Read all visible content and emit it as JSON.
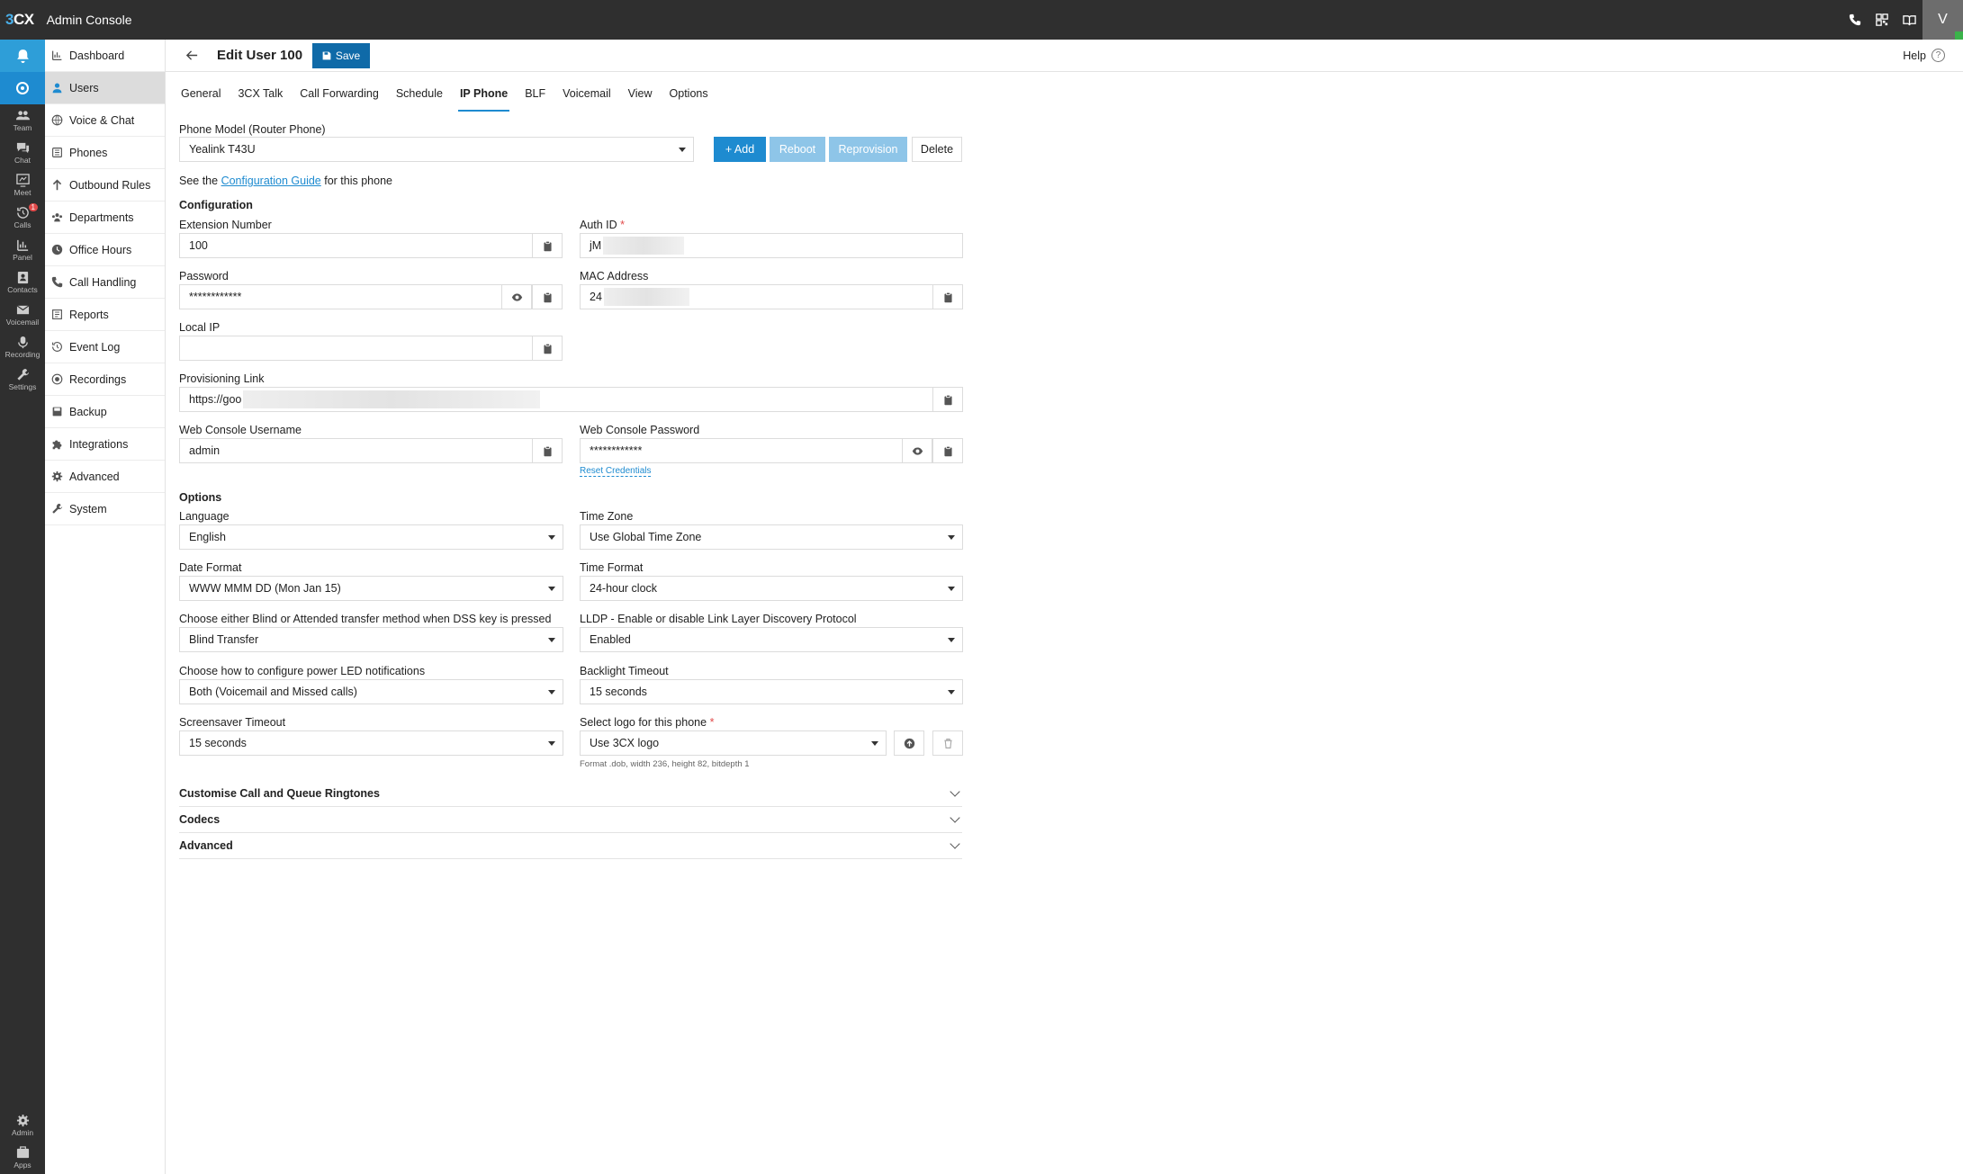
{
  "app": {
    "logo": "3CX",
    "title": "Admin Console",
    "avatar_letter": "V"
  },
  "topbar_icons": [
    "phone-icon",
    "qr-code-icon",
    "book-icon"
  ],
  "rail": {
    "items": [
      {
        "name": "team",
        "label": "Team"
      },
      {
        "name": "chat",
        "label": "Chat"
      },
      {
        "name": "meet",
        "label": "Meet"
      },
      {
        "name": "calls",
        "label": "Calls",
        "badge": "1"
      },
      {
        "name": "panel",
        "label": "Panel"
      },
      {
        "name": "contacts",
        "label": "Contacts"
      },
      {
        "name": "voicemail",
        "label": "Voicemail"
      },
      {
        "name": "recording",
        "label": "Recording"
      },
      {
        "name": "settings",
        "label": "Settings"
      }
    ],
    "bottom": [
      {
        "name": "admin",
        "label": "Admin"
      },
      {
        "name": "apps",
        "label": "Apps"
      }
    ]
  },
  "nav": {
    "items": [
      {
        "label": "Dashboard",
        "icon": "dashboard-icon"
      },
      {
        "label": "Users",
        "icon": "user-icon",
        "active": true
      },
      {
        "label": "Voice & Chat",
        "icon": "globe-icon"
      },
      {
        "label": "Phones",
        "icon": "phones-icon"
      },
      {
        "label": "Outbound Rules",
        "icon": "arrow-up-icon"
      },
      {
        "label": "Departments",
        "icon": "departments-icon"
      },
      {
        "label": "Office Hours",
        "icon": "clock-icon"
      },
      {
        "label": "Call Handling",
        "icon": "phone-icon"
      },
      {
        "label": "Reports",
        "icon": "reports-icon"
      },
      {
        "label": "Event Log",
        "icon": "history-icon"
      },
      {
        "label": "Recordings",
        "icon": "record-icon"
      },
      {
        "label": "Backup",
        "icon": "backup-icon"
      },
      {
        "label": "Integrations",
        "icon": "puzzle-icon"
      },
      {
        "label": "Advanced",
        "icon": "gear-icon"
      },
      {
        "label": "System",
        "icon": "wrench-icon"
      }
    ]
  },
  "header": {
    "title": "Edit User 100",
    "save_label": "Save",
    "help_label": "Help",
    "help_glyph": "?"
  },
  "tabs": [
    "General",
    "3CX Talk",
    "Call Forwarding",
    "Schedule",
    "IP Phone",
    "BLF",
    "Voicemail",
    "View",
    "Options"
  ],
  "active_tab": "IP Phone",
  "phone": {
    "model_label": "Phone Model (Router Phone)",
    "model_value": "Yealink T43U",
    "add_label": "+ Add",
    "reboot_label": "Reboot",
    "reprovision_label": "Reprovision",
    "delete_label": "Delete",
    "guide_prefix": "See the ",
    "guide_link": "Configuration Guide",
    "guide_suffix": " for this phone"
  },
  "configuration": {
    "heading": "Configuration",
    "extension_label": "Extension Number",
    "extension_value": "100",
    "auth_label": "Auth ID",
    "auth_required": "*",
    "auth_value": "jM",
    "password_label": "Password",
    "password_value": "************",
    "mac_label": "MAC Address",
    "mac_value": "24",
    "local_ip_label": "Local IP",
    "local_ip_value": "",
    "prov_label": "Provisioning Link",
    "prov_value": "https://goo",
    "web_user_label": "Web Console Username",
    "web_user_value": "admin",
    "web_pass_label": "Web Console Password",
    "web_pass_value": "************",
    "reset_label": "Reset Credentials"
  },
  "options": {
    "heading": "Options",
    "language_label": "Language",
    "language_value": "English",
    "timezone_label": "Time Zone",
    "timezone_value": "Use Global Time Zone",
    "date_label": "Date Format",
    "date_value": "WWW MMM DD (Mon Jan 15)",
    "time_label": "Time Format",
    "time_value": "24-hour clock",
    "transfer_label": "Choose either Blind or Attended transfer method when DSS key is pressed",
    "transfer_value": "Blind Transfer",
    "lldp_label": "LLDP - Enable or disable Link Layer Discovery Protocol",
    "lldp_value": "Enabled",
    "led_label": "Choose how to configure power LED notifications",
    "led_value": "Both (Voicemail and Missed calls)",
    "backlight_label": "Backlight Timeout",
    "backlight_value": "15 seconds",
    "screensaver_label": "Screensaver Timeout",
    "screensaver_value": "15 seconds",
    "logo_label": "Select logo for this phone",
    "logo_required": "*",
    "logo_value": "Use 3CX logo",
    "logo_hint": "Format .dob, width 236, height 82, bitdepth 1"
  },
  "accordions": [
    "Customise Call and Queue Ringtones",
    "Codecs",
    "Advanced"
  ]
}
